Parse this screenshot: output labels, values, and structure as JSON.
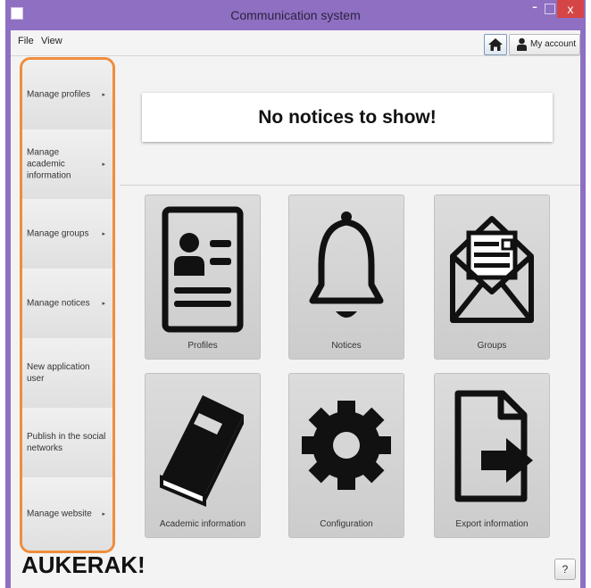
{
  "window": {
    "title": "Communication system",
    "minimize_icon": "minimize-icon",
    "maximize_icon": "maximize-icon",
    "close_label": "x"
  },
  "menubar": {
    "items": [
      {
        "label": "File"
      },
      {
        "label": "View"
      }
    ],
    "home_icon": "home-icon",
    "account_label": "My account",
    "account_icon": "user-icon"
  },
  "sidebar": {
    "items": [
      {
        "label": "Manage profiles",
        "has_submenu": true
      },
      {
        "label": "Manage academic information",
        "has_submenu": true
      },
      {
        "label": "Manage groups",
        "has_submenu": true
      },
      {
        "label": "Manage notices",
        "has_submenu": true
      },
      {
        "label": "New application user",
        "has_submenu": false
      },
      {
        "label": "Publish in the social networks",
        "has_submenu": false
      },
      {
        "label": "Manage website",
        "has_submenu": true
      }
    ],
    "arrow": "▸",
    "highlight_color": "#f08d3c"
  },
  "main": {
    "notice_text": "No notices to show!",
    "tiles": [
      {
        "label": "Profiles",
        "icon": "profile-card-icon"
      },
      {
        "label": "Notices",
        "icon": "bell-icon"
      },
      {
        "label": "Groups",
        "icon": "envelope-icon"
      },
      {
        "label": "Academic information",
        "icon": "book-icon"
      },
      {
        "label": "Configuration",
        "icon": "gear-icon"
      },
      {
        "label": "Export information",
        "icon": "export-file-icon"
      }
    ]
  },
  "footer": {
    "brand": "AUKERAK!",
    "help_label": "?"
  },
  "colors": {
    "titlebar": "#8e6fc2",
    "close_button": "#d64545",
    "sidebar_outline": "#f08d3c"
  }
}
